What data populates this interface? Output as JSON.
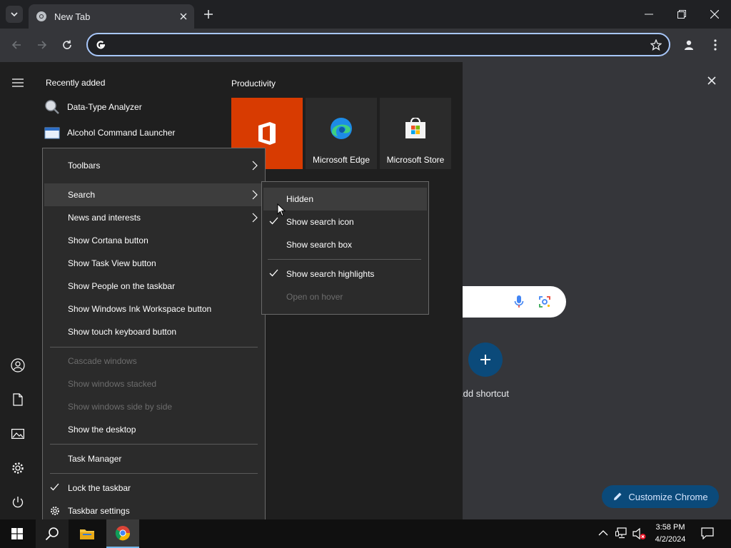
{
  "browser": {
    "tab_title": "New Tab",
    "omnibox_placeholder": ""
  },
  "start_menu": {
    "recently_added_title": "Recently added",
    "recent_apps": [
      {
        "label": "Data-Type Analyzer"
      },
      {
        "label": "Alcohol Command Launcher"
      }
    ],
    "productivity_title": "Productivity",
    "tiles": [
      {
        "label": "",
        "color": "#d83b01"
      },
      {
        "label": "Microsoft Edge",
        "color": "#2b2b2b"
      },
      {
        "label": "Microsoft Store",
        "color": "#2b2b2b"
      }
    ]
  },
  "context_menu": {
    "items": [
      {
        "label": "Toolbars",
        "submenu": true
      },
      {
        "label": "Search",
        "submenu": true,
        "highlighted": true
      },
      {
        "label": "News and interests",
        "submenu": true
      },
      {
        "label": "Show Cortana button"
      },
      {
        "label": "Show Task View button"
      },
      {
        "label": "Show People on the taskbar"
      },
      {
        "label": "Show Windows Ink Workspace button"
      },
      {
        "label": "Show touch keyboard button"
      },
      {
        "label": "Cascade windows",
        "disabled": true
      },
      {
        "label": "Show windows stacked",
        "disabled": true
      },
      {
        "label": "Show windows side by side",
        "disabled": true
      },
      {
        "label": "Show the desktop"
      },
      {
        "label": "Task Manager"
      },
      {
        "label": "Lock the taskbar",
        "checked": true
      },
      {
        "label": "Taskbar settings",
        "icon": "gear-icon"
      }
    ]
  },
  "search_submenu": {
    "items": [
      {
        "label": "Hidden",
        "highlighted": true
      },
      {
        "label": "Show search icon",
        "checked": true
      },
      {
        "label": "Show search box"
      },
      {
        "label": "Show search highlights",
        "checked": true
      },
      {
        "label": "Open on hover",
        "disabled": true
      }
    ]
  },
  "ntp": {
    "add_shortcut_label": "Add shortcut",
    "customize_label": "Customize Chrome"
  },
  "taskbar": {
    "time": "3:58 PM",
    "date": "4/2/2024"
  },
  "colors": {
    "accent": "#a8c7fa",
    "office_tile": "#d83b01",
    "customize_bg": "#0b4a7a"
  }
}
